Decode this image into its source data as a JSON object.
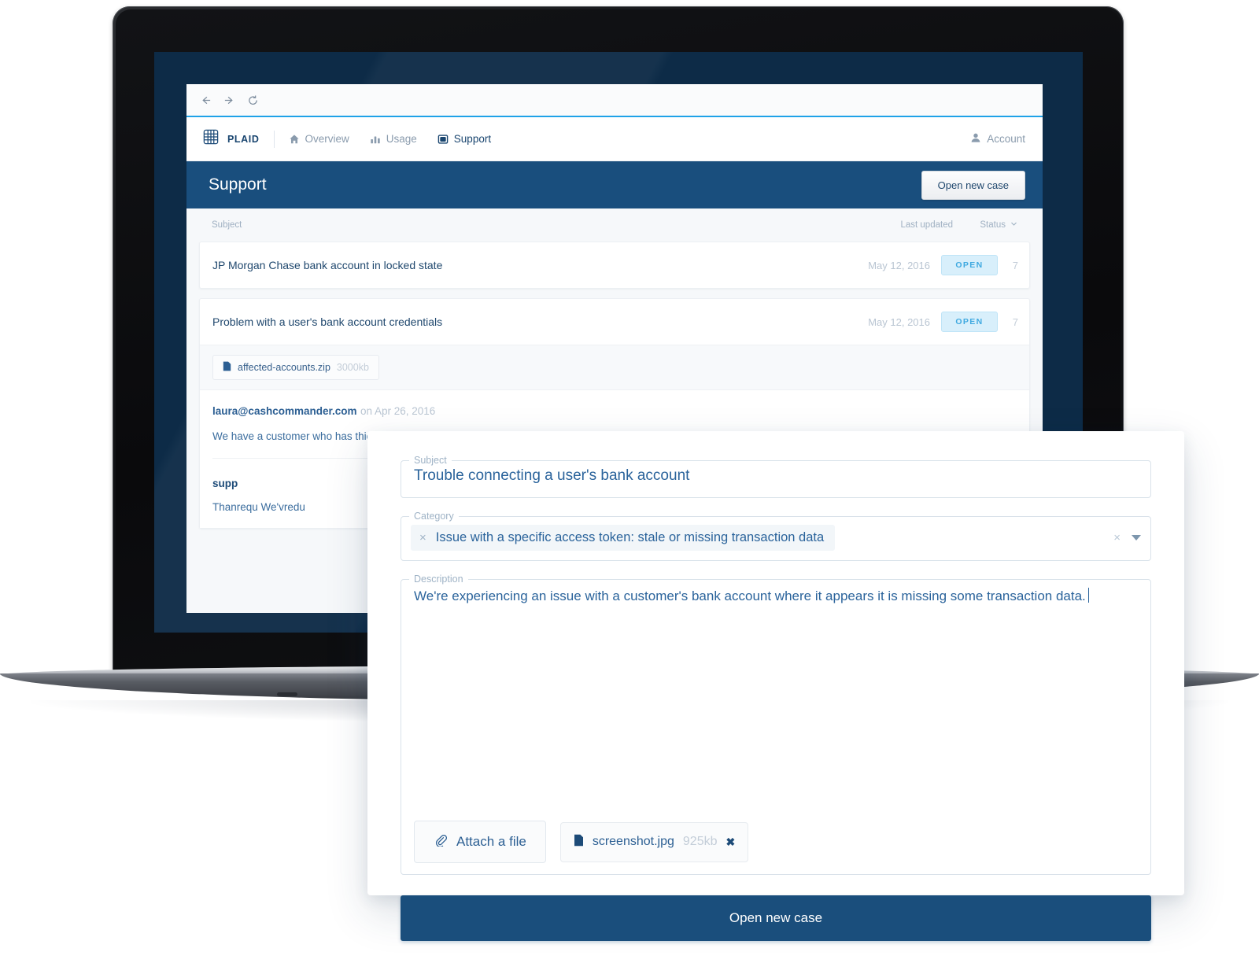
{
  "browser": {
    "back_icon": "arrow-left-icon",
    "forward_icon": "arrow-right-icon",
    "reload_icon": "reload-icon"
  },
  "app_header": {
    "logo_icon": "plaid-knot-logo-icon",
    "brand": "PLAID",
    "nav": [
      {
        "label": "Overview",
        "icon": "home-icon",
        "active": false
      },
      {
        "label": "Usage",
        "icon": "bar-chart-icon",
        "active": false
      },
      {
        "label": "Support",
        "icon": "inbox-icon",
        "active": true
      }
    ],
    "account": {
      "label": "Account",
      "icon": "user-icon"
    }
  },
  "page": {
    "title": "Support",
    "open_case_button": "Open new case",
    "columns": {
      "subject": "Subject",
      "last_updated": "Last updated",
      "status": "Status",
      "status_caret": "chevron-down-icon"
    },
    "cases": [
      {
        "subject": "JP Morgan Chase bank account in locked state",
        "last_updated": "May 12, 2016",
        "status": "OPEN",
        "count": "7"
      },
      {
        "subject": "Problem with a user's bank account credentials",
        "last_updated": "May 12, 2016",
        "status": "OPEN",
        "count": "7",
        "attachment": {
          "name": "affected-accounts.zip",
          "size": "3000kb",
          "icon": "file-icon"
        },
        "messages": [
          {
            "from": "laura@cashcommander.com",
            "when": "on Apr 26, 2016",
            "body": "We have a customer who has thier bank account many times. I checked yesterday for the following access token and got an there"
          },
          {
            "from": "supp",
            "body": "Thanrequ We'vredu"
          }
        ]
      }
    ]
  },
  "modal": {
    "subject": {
      "legend": "Subject",
      "value": "Trouble connecting a user's bank account",
      "placeholder": "Subject"
    },
    "category": {
      "legend": "Category",
      "selected": "Issue with a specific access token: stale or missing transaction data",
      "remove_tag_icon": "close-x-icon",
      "clear_icon": "clear-x-icon",
      "dropdown_icon": "chevron-down-icon"
    },
    "description": {
      "legend": "Description",
      "value": "We're experiencing an issue with a customer's bank account where it appears it is missing some transaction data.",
      "placeholder": "Description"
    },
    "attach_button": {
      "label": "Attach a file",
      "icon": "paperclip-icon"
    },
    "attachment": {
      "name": "screenshot.jpg",
      "size": "925kb",
      "icon": "file-icon",
      "remove_icon": "close-x-icon"
    },
    "submit_button": "Open new case"
  },
  "colors": {
    "brand_navy": "#194e7d",
    "accent_blue": "#1fa2e8",
    "badge_bg": "#d8effb",
    "badge_text": "#3fa9e0",
    "screen_bg": "#0d2b47",
    "text_blue": "#2a639b"
  }
}
